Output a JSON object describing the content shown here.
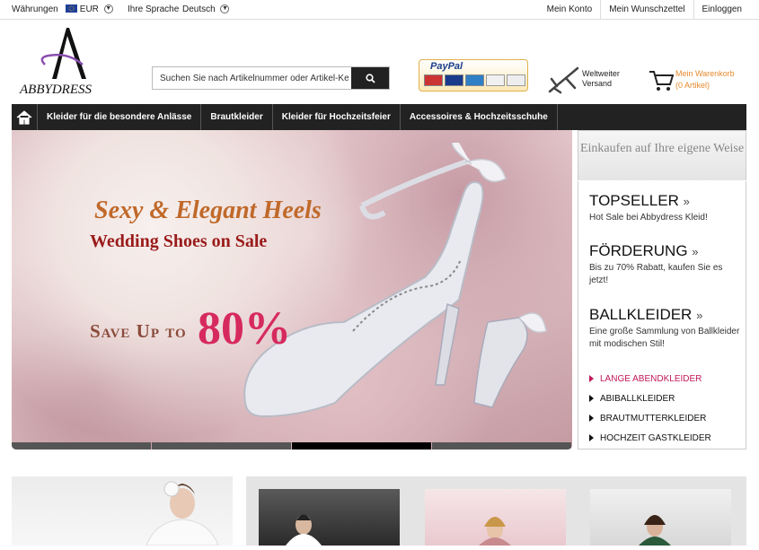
{
  "topbar": {
    "currency_label": "Währungen",
    "currency_value": "EUR",
    "language_label": "Ihre Sprache",
    "language_value": "Deutsch",
    "links": [
      "Mein Konto",
      "Mein Wunschzettel",
      "Einloggen"
    ]
  },
  "logo": {
    "text": "ABBYDRESS",
    "letter": "A"
  },
  "search": {
    "placeholder": "Suchen Sie nach Artikelnummer oder Artikel-Keyw"
  },
  "payment": {
    "brand": "PayPal",
    "cards": [
      "MC",
      "VISA",
      "AMEX",
      "DISCOVER",
      "BANK"
    ]
  },
  "shipping": {
    "line1": "Weltweiter",
    "line2": "Versand"
  },
  "cart": {
    "label": "Mein Warenkorb",
    "count": "(0 Artikel)"
  },
  "nav": {
    "items": [
      "Kleider für die besondere Anlässe",
      "Brautkleider",
      "Kleider für Hochzeitsfeier",
      "Accessoires & Hochzeitsschuhe"
    ]
  },
  "banner": {
    "headline": "Sexy & Elegant Heels",
    "subheadline": "Wedding Shoes on Sale",
    "save_text": "Save Up to",
    "percent": "80%",
    "active_slide": 3,
    "slides": 4
  },
  "sidebar": {
    "header": "Einkaufen auf Ihre eigene Weise",
    "sections": [
      {
        "title": "TOPSELLER",
        "text": "Hot Sale bei Abbydress Kleid!"
      },
      {
        "title": "FÖRDERUNG",
        "text": "Bis zu 70% Rabatt, kaufen Sie es jetzt!"
      },
      {
        "title": "BALLKLEIDER",
        "text": "Eine große Sammlung von Ballkleider mit modischen Stil!"
      }
    ],
    "links": [
      "LANGE ABENDKLEIDER",
      "ABIBALLKLEIDER",
      "BRAUTMUTTERKLEIDER",
      "HOCHZEIT GASTKLEIDER"
    ],
    "active_link": 0
  },
  "colors": {
    "nav_bg": "#222222",
    "accent": "#c0185a",
    "cart": "#e68a2e"
  }
}
